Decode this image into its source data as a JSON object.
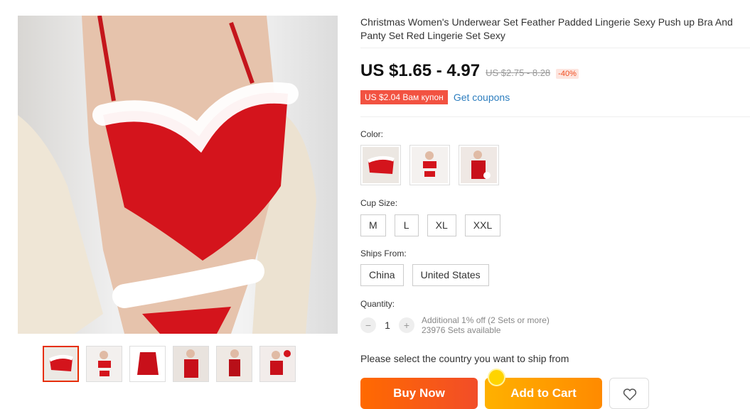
{
  "product": {
    "title": "Christmas Women's Underwear Set Feather Padded Lingerie Sexy Push up Bra And Panty Set Red Lingerie Set Sexy",
    "price": "US $1.65 - 4.97",
    "old_price": "US $2.75 - 8.28",
    "discount": "-40%"
  },
  "coupon": {
    "badge": "US $2.04 Вам купон",
    "link": "Get coupons"
  },
  "color": {
    "label": "Color:",
    "options": [
      "color-option-1",
      "color-option-2",
      "color-option-3"
    ]
  },
  "cup_size": {
    "label": "Cup Size:",
    "options": [
      "M",
      "L",
      "XL",
      "XXL"
    ]
  },
  "ships_from": {
    "label": "Ships From:",
    "options": [
      "China",
      "United States"
    ]
  },
  "quantity": {
    "label": "Quantity:",
    "value": "1",
    "minus": "−",
    "plus": "+",
    "discount_note": "Additional 1% off (2 Sets or more)",
    "available": "23976 Sets available"
  },
  "ship_notice": "Please select the country you want to ship from",
  "actions": {
    "buy_now": "Buy Now",
    "add_to_cart": "Add to Cart",
    "wishlist_icon": "heart-icon"
  },
  "colors": {
    "price_red": "#e62e04",
    "buy_orange": "#ff6a00",
    "cart_yellow": "#ffb100",
    "coupon_red": "#f25241",
    "link_blue": "#2d7ebf"
  }
}
